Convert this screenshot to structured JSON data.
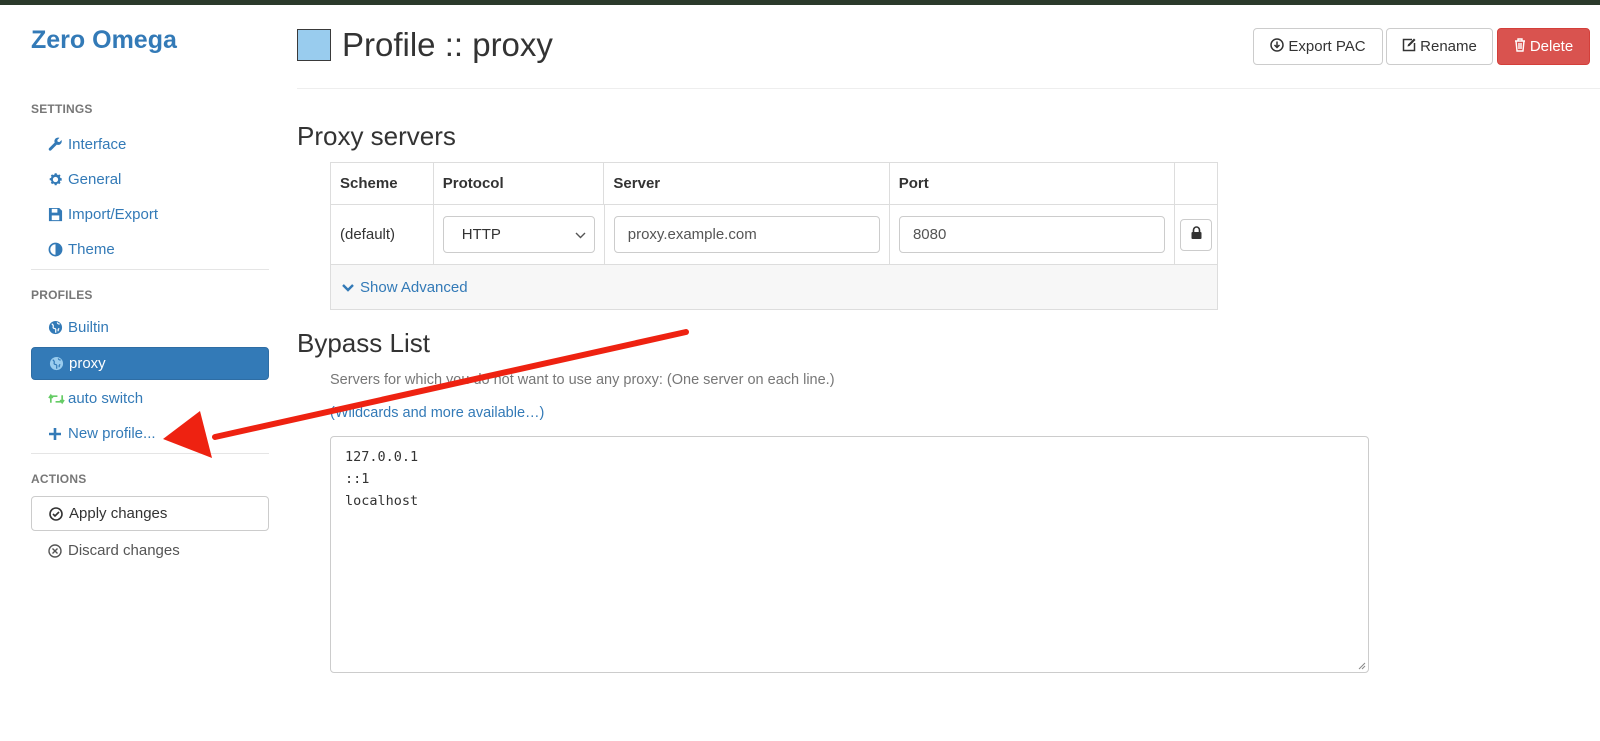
{
  "brand": "Zero Omega",
  "sidebar": {
    "settings_header": "SETTINGS",
    "settings_items": [
      {
        "label": "Interface",
        "icon": "wrench-icon"
      },
      {
        "label": "General",
        "icon": "gear-icon"
      },
      {
        "label": "Import/Export",
        "icon": "floppy-icon"
      },
      {
        "label": "Theme",
        "icon": "contrast-icon"
      }
    ],
    "profiles_header": "PROFILES",
    "profile_items": [
      {
        "label": "Builtin",
        "icon": "globe-icon"
      },
      {
        "label": "proxy",
        "icon": "globe-icon",
        "active": true
      },
      {
        "label": "auto switch",
        "icon": "retweet-icon"
      },
      {
        "label": "New profile...",
        "icon": "plus-icon"
      }
    ],
    "actions_header": "ACTIONS",
    "apply_label": "Apply changes",
    "discard_label": "Discard changes"
  },
  "header": {
    "title": "Profile :: proxy",
    "profile_color": "#99ccee",
    "export_label": "Export PAC",
    "rename_label": "Rename",
    "delete_label": "Delete"
  },
  "proxy_servers": {
    "title": "Proxy servers",
    "columns": [
      "Scheme",
      "Protocol",
      "Server",
      "Port"
    ],
    "row": {
      "scheme": "(default)",
      "protocol": "HTTP",
      "server": "proxy.example.com",
      "port": "8080"
    },
    "show_advanced": "Show Advanced"
  },
  "bypass": {
    "title": "Bypass List",
    "help": "Servers for which you do not want to use any proxy: (One server on each line.)",
    "wildcards_link": "(Wildcards and more available…)",
    "entries": [
      "127.0.0.1",
      "::1",
      "localhost"
    ]
  },
  "colors": {
    "accent": "#337ab7",
    "danger": "#d9534f",
    "annotation_arrow": "#ee2211"
  }
}
